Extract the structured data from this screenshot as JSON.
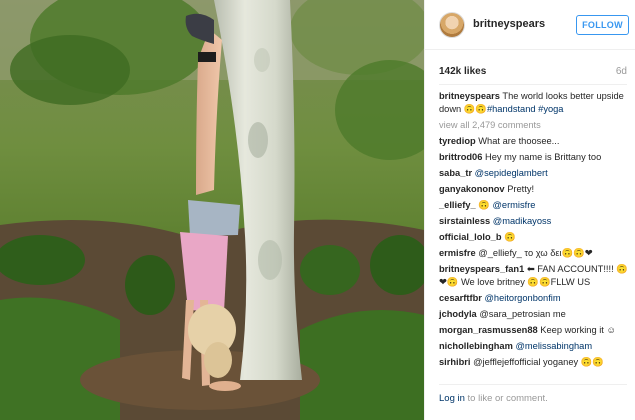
{
  "post": {
    "username": "britneyspears",
    "follow_label": "FOLLOW",
    "likes": "142k likes",
    "age": "6d"
  },
  "caption": {
    "user": "britneyspears",
    "text": "The world looks better upside down 🙃🙃",
    "tags": "#handstand #yoga"
  },
  "view_all": "view all 2,479 comments",
  "comments": [
    {
      "user": "tyrediop",
      "text": "What are thoosee..."
    },
    {
      "user": "brittrod06",
      "text": "Hey my name is Brittany too"
    },
    {
      "user": "saba_tr",
      "text": "@sepideglambert"
    },
    {
      "user": "ganyakononov",
      "text": "Pretty!"
    },
    {
      "user": "_elliefy_",
      "text": "🙃 @ermisfre"
    },
    {
      "user": "sirstainless",
      "text": "@madikayoss"
    },
    {
      "user": "official_lolo_b",
      "text": "🙃"
    },
    {
      "user": "ermisfre",
      "text": "@_elliefy_ το χω δει🙃🙃❤"
    },
    {
      "user": "britneyspears_fan1",
      "text": "⬅ FAN ACCOUNT!!!! 🙃❤🙃 We love britney 🙃🙃FLLW US"
    },
    {
      "user": "cesarftfbr",
      "text": "@heitorgonbonfim"
    },
    {
      "user": "jchodyla",
      "text": "@sara_petrosian me"
    },
    {
      "user": "morgan_rasmussen88",
      "text": "Keep working it ☺"
    },
    {
      "user": "nichollebingham",
      "text": "@melissabingham"
    },
    {
      "user": "sirhibri",
      "text": "@jefflejeffofficial yoganey 🙃🙃"
    }
  ],
  "login": {
    "link": "Log in",
    "rest": "to like or comment."
  },
  "icons": {
    "avatar": "profile-avatar",
    "options": "more-options"
  },
  "colors": {
    "accent": "#3897f0",
    "link": "#003569",
    "muted": "#999999",
    "text": "#262626"
  }
}
